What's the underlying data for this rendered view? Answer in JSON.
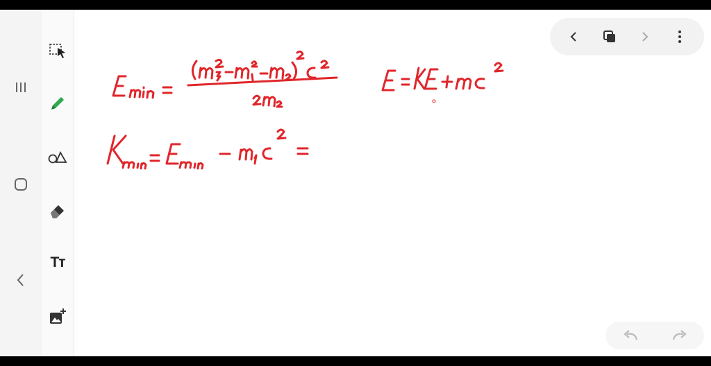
{
  "ink_color": "#e0262b",
  "tool_accent": "#2fa84f",
  "nav": {
    "recents_icon": "recents-icon",
    "home_icon": "home-icon",
    "back_icon": "back-icon"
  },
  "tools": [
    {
      "name": "lasso-select-tool",
      "icon": "lasso-select-icon"
    },
    {
      "name": "pen-tool",
      "icon": "pen-icon"
    },
    {
      "name": "shapes-tool",
      "icon": "shapes-icon"
    },
    {
      "name": "eraser-tool",
      "icon": "eraser-icon"
    },
    {
      "name": "text-tool",
      "icon": "text-icon",
      "label": "Tт"
    },
    {
      "name": "insert-image-tool",
      "icon": "add-image-icon"
    }
  ],
  "page_nav": {
    "prev_icon": "chevron-left-icon",
    "pages_icon": "pages-icon",
    "next_icon": "chevron-right-icon",
    "more_icon": "more-vertical-icon"
  },
  "history": {
    "undo_icon": "undo-icon",
    "redo_icon": "redo-icon"
  }
}
